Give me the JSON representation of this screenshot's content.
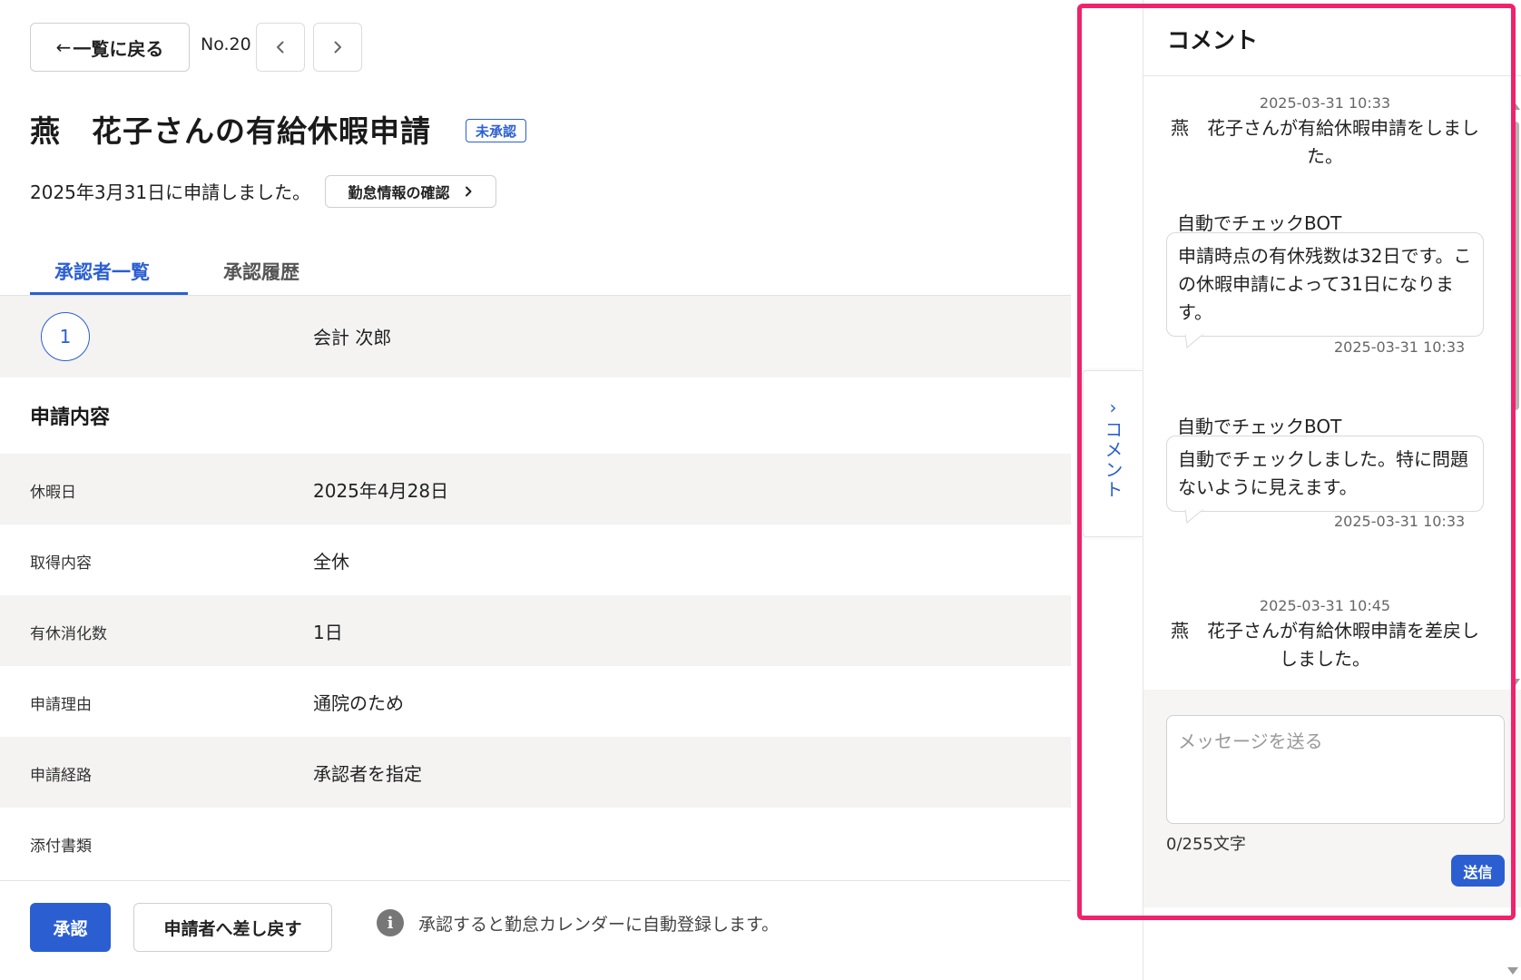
{
  "header": {
    "back_arrow": "←",
    "back_label": "一覧に戻る",
    "doc_number": "No.20",
    "prev_icon": "chevron-left-icon",
    "next_icon": "chevron-right-icon"
  },
  "page": {
    "title": "燕　花子さんの有給休暇申請",
    "status": "未承認",
    "applied_text": "2025年3月31日に申請しました。",
    "attendance_button": "勤怠情報の確認"
  },
  "tabs": [
    {
      "label": "承認者一覧",
      "active": true
    },
    {
      "label": "承認履歴",
      "active": false
    }
  ],
  "approvers": [
    {
      "number": "1",
      "name": "会計 次郎"
    }
  ],
  "section_title": "申請内容",
  "details": [
    {
      "label": "休暇日",
      "value": "2025年4月28日"
    },
    {
      "label": "取得内容",
      "value": "全休"
    },
    {
      "label": "有休消化数",
      "value": "1日"
    },
    {
      "label": "申請理由",
      "value": "通院のため"
    },
    {
      "label": "申請経路",
      "value": "承認者を指定"
    },
    {
      "label": "添付書類",
      "value": ""
    }
  ],
  "footer": {
    "approve_label": "承認",
    "return_label": "申請者へ差し戻す",
    "info_icon": "info-icon",
    "info_glyph": "i",
    "info_text": "承認すると勤怠カレンダーに自動登録します。"
  },
  "comments": {
    "toggle_chevron": "›",
    "toggle_label": "コメント",
    "header_title": "コメント",
    "items": [
      {
        "type": "system",
        "time": "2025-03-31 10:33",
        "text": "燕　花子さんが有給休暇申請をしました。"
      },
      {
        "type": "bot",
        "author": "自動でチェックBOT",
        "text": "申請時点の有休残数は32日です。この休暇申請によって31日になります。",
        "time": "2025-03-31 10:33"
      },
      {
        "type": "bot",
        "author": "自動でチェックBOT",
        "text": "自動でチェックしました。特に問題ないように見えます。",
        "time": "2025-03-31 10:33"
      },
      {
        "type": "system",
        "time": "2025-03-31 10:45",
        "text": "燕　花子さんが有給休暇申請を差戻ししました。"
      }
    ],
    "input_placeholder": "メッセージを送る",
    "input_value": "",
    "char_count": "0/255文字",
    "send_label": "送信"
  },
  "colors": {
    "accent": "#2b5fd1",
    "highlight": "#f0226a",
    "row_shade": "#f4f3f2"
  }
}
